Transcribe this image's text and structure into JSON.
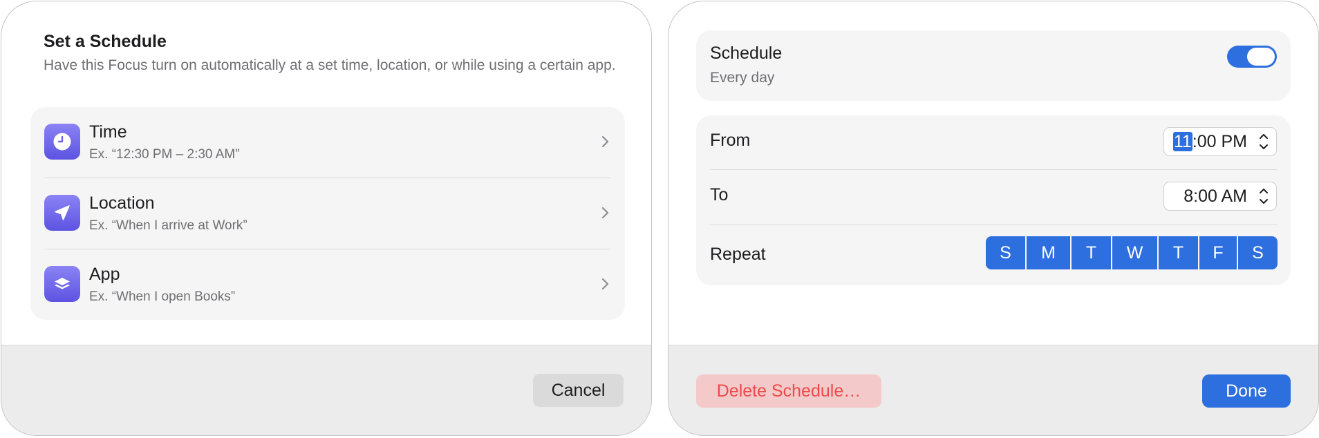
{
  "schedule_picker": {
    "title": "Set a Schedule",
    "subtitle": "Have this Focus turn on automatically at a set time, location, or while using a certain app.",
    "options": [
      {
        "title": "Time",
        "subtitle": "Ex. “12:30 PM – 2:30 AM”",
        "icon": "clock-icon"
      },
      {
        "title": "Location",
        "subtitle": "Ex. “When I arrive at Work”",
        "icon": "location-arrow-icon"
      },
      {
        "title": "App",
        "subtitle": "Ex. “When I open Books”",
        "icon": "app-stack-icon"
      }
    ],
    "cancel_label": "Cancel"
  },
  "schedule_editor": {
    "schedule_label": "Schedule",
    "schedule_summary": "Every day",
    "schedule_enabled": true,
    "from_label": "From",
    "from_time_hour": "11",
    "from_time_rest": ":00 PM",
    "to_label": "To",
    "to_time": "8:00 AM",
    "repeat_label": "Repeat",
    "days": [
      "S",
      "M",
      "T",
      "W",
      "T",
      "F",
      "S"
    ],
    "delete_label": "Delete Schedule…",
    "done_label": "Done"
  },
  "colors": {
    "accent": "#2d6fde",
    "icon_purple": "#6b62ea",
    "destructive": "#ec4a4a",
    "destructive_bg": "#f4c9c9"
  }
}
